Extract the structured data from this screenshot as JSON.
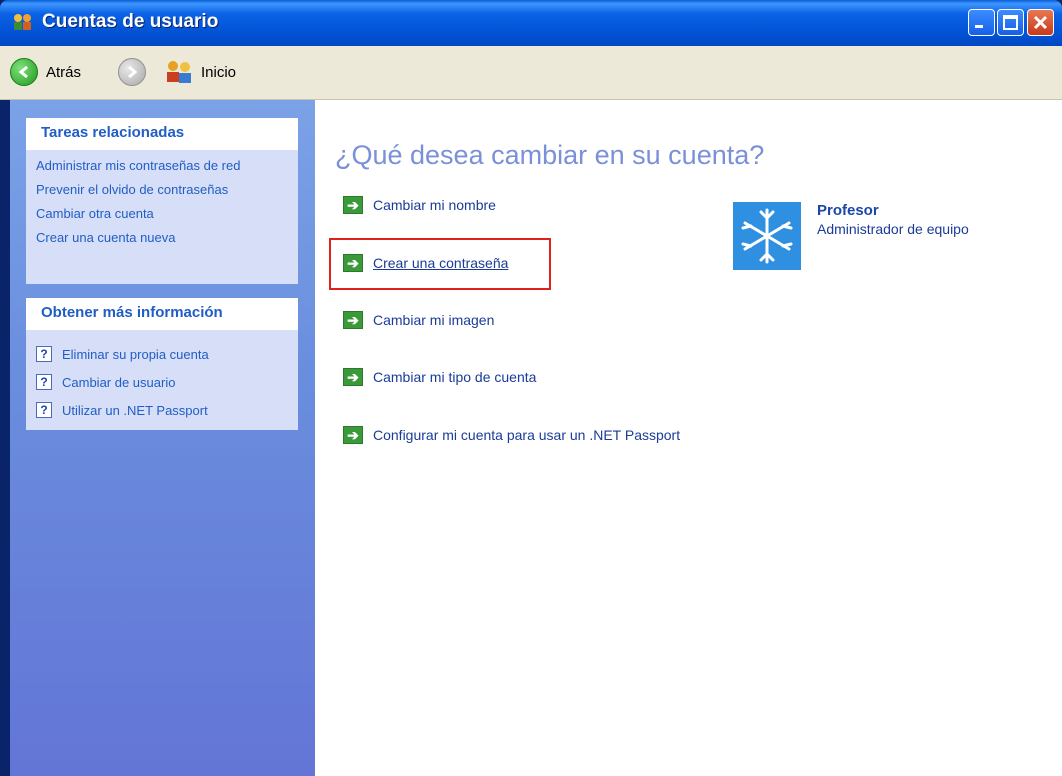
{
  "window": {
    "title": "Cuentas de usuario"
  },
  "toolbar": {
    "back_label": "Atrás",
    "home_label": "Inicio"
  },
  "sidebar": {
    "related_tasks": {
      "heading": "Tareas relacionadas",
      "items": [
        "Administrar mis contraseñas de red",
        "Prevenir el olvido de contraseñas",
        "Cambiar otra cuenta",
        "Crear una cuenta nueva"
      ]
    },
    "more_info": {
      "heading": "Obtener más información",
      "items": [
        "Eliminar su propia cuenta",
        "Cambiar de usuario",
        "Utilizar un .NET Passport"
      ]
    }
  },
  "main": {
    "heading": "¿Qué desea cambiar en su cuenta?",
    "actions": [
      "Cambiar mi nombre",
      "Crear una contraseña",
      "Cambiar mi imagen",
      "Cambiar mi tipo de cuenta",
      "Configurar mi cuenta para usar un .NET Passport"
    ],
    "user": {
      "name": "Profesor",
      "role": "Administrador de equipo"
    }
  },
  "colors": {
    "highlight": "#e02020",
    "link": "#215dc6",
    "sidebar": "#6a8ede"
  }
}
